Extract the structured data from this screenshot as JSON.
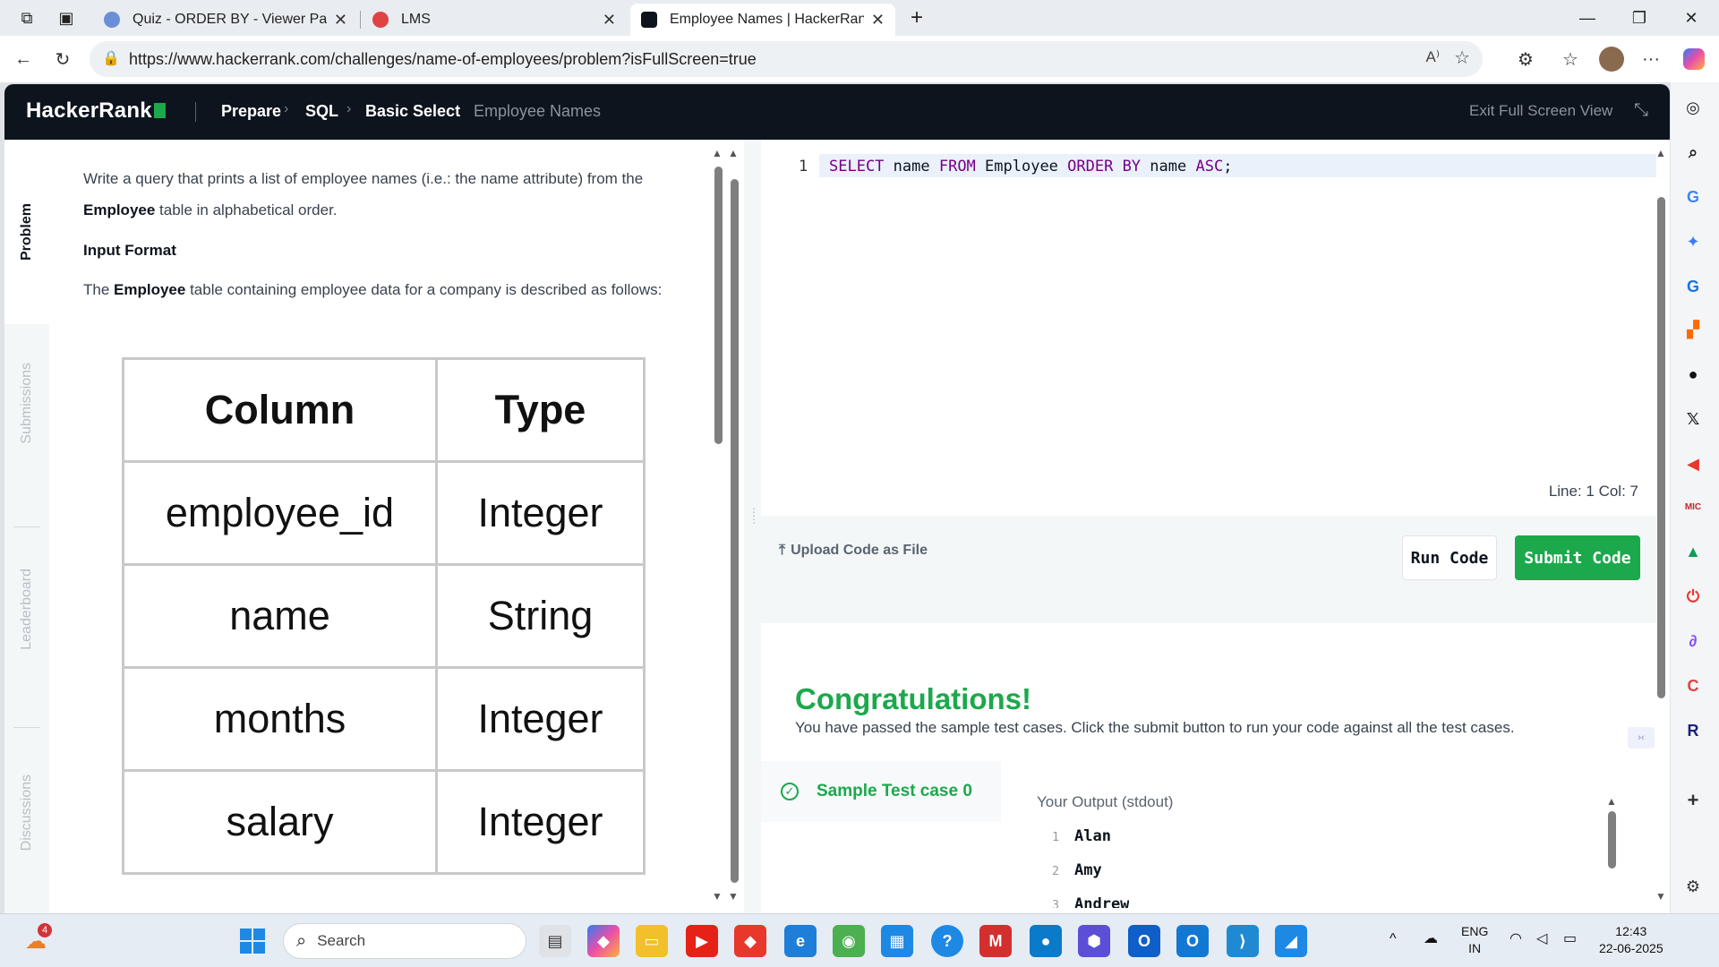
{
  "browser": {
    "tabs": [
      {
        "title": "Quiz - ORDER BY - Viewer Page |",
        "favicon_color": "#6b8fd6"
      },
      {
        "title": "LMS",
        "favicon_color": "#e04343"
      },
      {
        "title": "Employee Names | HackerRank",
        "favicon_color": "#0e141e",
        "active": true
      }
    ],
    "url": "https://www.hackerrank.com/challenges/name-of-employees/problem?isFullScreen=true",
    "window_controls": [
      "minimize-icon",
      "maximize-icon",
      "close-icon"
    ]
  },
  "header": {
    "logo": "HackerRank",
    "breadcrumb": [
      "Prepare",
      "SQL",
      "Basic Select",
      "Employee Names"
    ],
    "exit_fullscreen": "Exit Full Screen View"
  },
  "vertical_tabs": [
    "Problem",
    "Submissions",
    "Leaderboard",
    "Discussions"
  ],
  "problem": {
    "intro_before": "Write a query that prints a list of employee names (i.e.: the name attribute) from the",
    "intro_bold": "Employee",
    "intro_after": "table in alphabetical order.",
    "input_format_heading": "Input Format",
    "desc_before": "The",
    "desc_bold": "Employee",
    "desc_after": "table containing employee data for a company is described as follows:",
    "table": {
      "headers": [
        "Column",
        "Type"
      ],
      "rows": [
        [
          "employee_id",
          "Integer"
        ],
        [
          "name",
          "String"
        ],
        [
          "months",
          "Integer"
        ],
        [
          "salary",
          "Integer"
        ]
      ]
    }
  },
  "editor": {
    "line_number": "1",
    "code_tokens": [
      {
        "t": "SELECT",
        "kw": true
      },
      {
        "t": " name ",
        "kw": false
      },
      {
        "t": "FROM",
        "kw": true
      },
      {
        "t": " Employee ",
        "kw": false
      },
      {
        "t": "ORDER BY",
        "kw": true
      },
      {
        "t": " name ",
        "kw": false
      },
      {
        "t": "ASC",
        "kw": true
      },
      {
        "t": ";",
        "kw": false
      }
    ],
    "status": "Line: 1 Col: 7"
  },
  "actions": {
    "upload": "Upload Code as File",
    "run": "Run Code",
    "submit": "Submit Code"
  },
  "results": {
    "title": "Congratulations!",
    "message": "You have passed the sample test cases. Click the submit button to run your code against all the test cases.",
    "testcase": "Sample Test case 0",
    "output_title": "Your Output (stdout)",
    "output_lines": [
      {
        "n": "1",
        "v": "Alan"
      },
      {
        "n": "2",
        "v": "Amy"
      },
      {
        "n": "3",
        "v": "Andrew"
      }
    ]
  },
  "taskbar": {
    "search_placeholder": "Search",
    "notification_badge": "4",
    "lang": "ENG",
    "region": "IN",
    "time": "12:43",
    "date": "22-06-2025"
  }
}
